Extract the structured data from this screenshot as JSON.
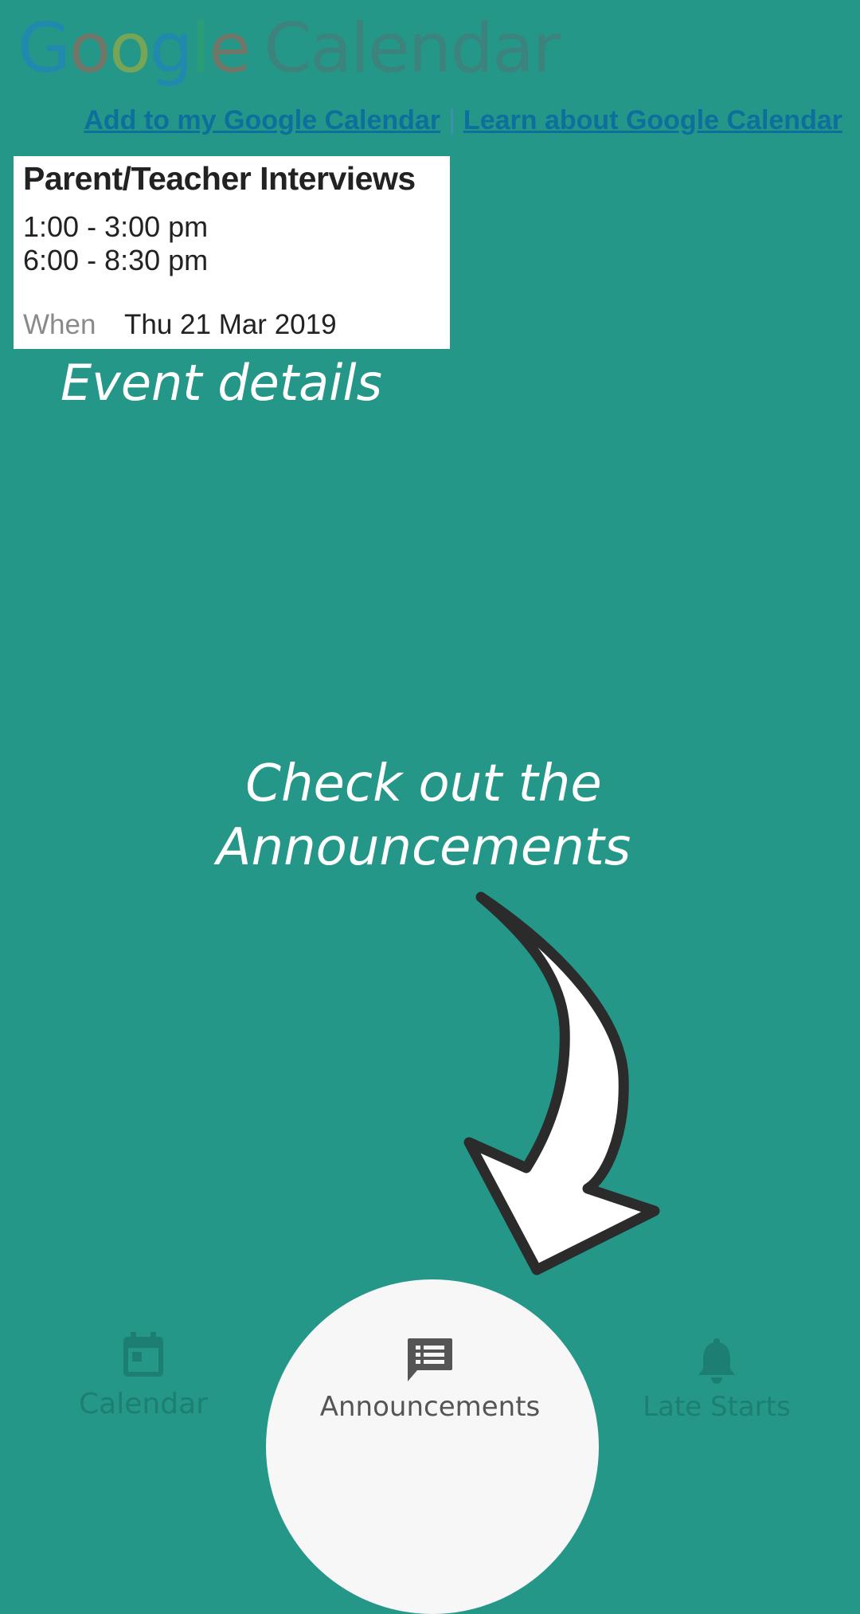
{
  "logo": {
    "g1": "G",
    "g2": "o",
    "g3": "o",
    "g4": "g",
    "g5": "l",
    "g6": "e",
    "calendar": "Calendar"
  },
  "links": {
    "add": "Add to my Google Calendar",
    "separator": "|",
    "learn": "Learn about Google Calendar"
  },
  "event": {
    "title": "Parent/Teacher Interviews",
    "times": [
      "1:00 - 3:00 pm",
      "6:00 - 8:30 pm"
    ],
    "when_label": "When",
    "when_value": "Thu 21 Mar 2019"
  },
  "annotations": {
    "event_details": "Event details",
    "check_line1": "Check out the",
    "check_line2": "Announcements"
  },
  "bottom_nav": {
    "items": [
      {
        "label": "Calendar",
        "icon": "calendar-icon"
      },
      {
        "label": "Announcements",
        "icon": "announcement-icon",
        "selected": true
      },
      {
        "label": "Late Starts",
        "icon": "bell-icon"
      }
    ]
  },
  "colors": {
    "background": "#259789",
    "accent": "#1d7f73",
    "card": "#ffffff",
    "nav_selected_bg": "#f7f7f7"
  }
}
